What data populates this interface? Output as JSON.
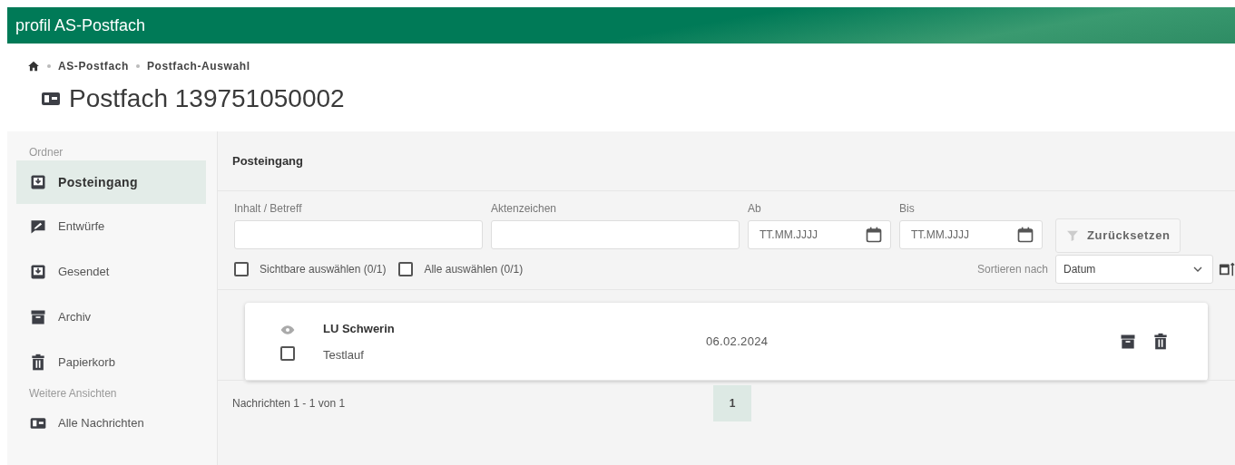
{
  "app_title": "profil AS-Postfach",
  "breadcrumb": [
    {
      "label": "AS-Postfach"
    },
    {
      "label": "Postfach-Auswahl"
    }
  ],
  "page_title": "Postfach 139751050002",
  "sidebar": {
    "sections": [
      {
        "heading": "Ordner",
        "items": [
          {
            "label": "Posteingang",
            "kind": "inbox",
            "selected": true
          },
          {
            "label": "Entwürfe",
            "kind": "draft",
            "selected": false
          },
          {
            "label": "Gesendet",
            "kind": "inbox",
            "selected": false
          },
          {
            "label": "Archiv",
            "kind": "archive",
            "selected": false
          },
          {
            "label": "Papierkorb",
            "kind": "trash",
            "selected": false
          }
        ]
      },
      {
        "heading": "Weitere Ansichten",
        "items": [
          {
            "label": "Alle Nachrichten",
            "kind": "mailbox",
            "selected": false
          }
        ]
      }
    ]
  },
  "panel_title": "Posteingang",
  "filters": [
    {
      "label": "Inhalt / Betreff",
      "kind": "text"
    },
    {
      "label": "Aktenzeichen",
      "kind": "text"
    },
    {
      "label": "Ab",
      "kind": "date",
      "placeholder": "TT.MM.JJJJ"
    },
    {
      "label": "Bis",
      "kind": "date",
      "placeholder": "TT.MM.JJJJ"
    }
  ],
  "reset_button": "Zurücksetzen",
  "select_options": [
    {
      "label": "Sichtbare auswählen (0/1)",
      "checked": false
    },
    {
      "label": "Alle auswählen (0/1)",
      "checked": false
    }
  ],
  "sort": {
    "label": "Sortieren nach",
    "value": "Datum"
  },
  "messages": [
    {
      "sender": "LU Schwerin",
      "subject": "Testlauf",
      "date": "06.02.2024",
      "read": true,
      "checked": false
    }
  ],
  "footer": {
    "count": "Nachrichten 1 - 1 von 1",
    "pages": [
      {
        "label": "1",
        "selected": true
      }
    ]
  }
}
